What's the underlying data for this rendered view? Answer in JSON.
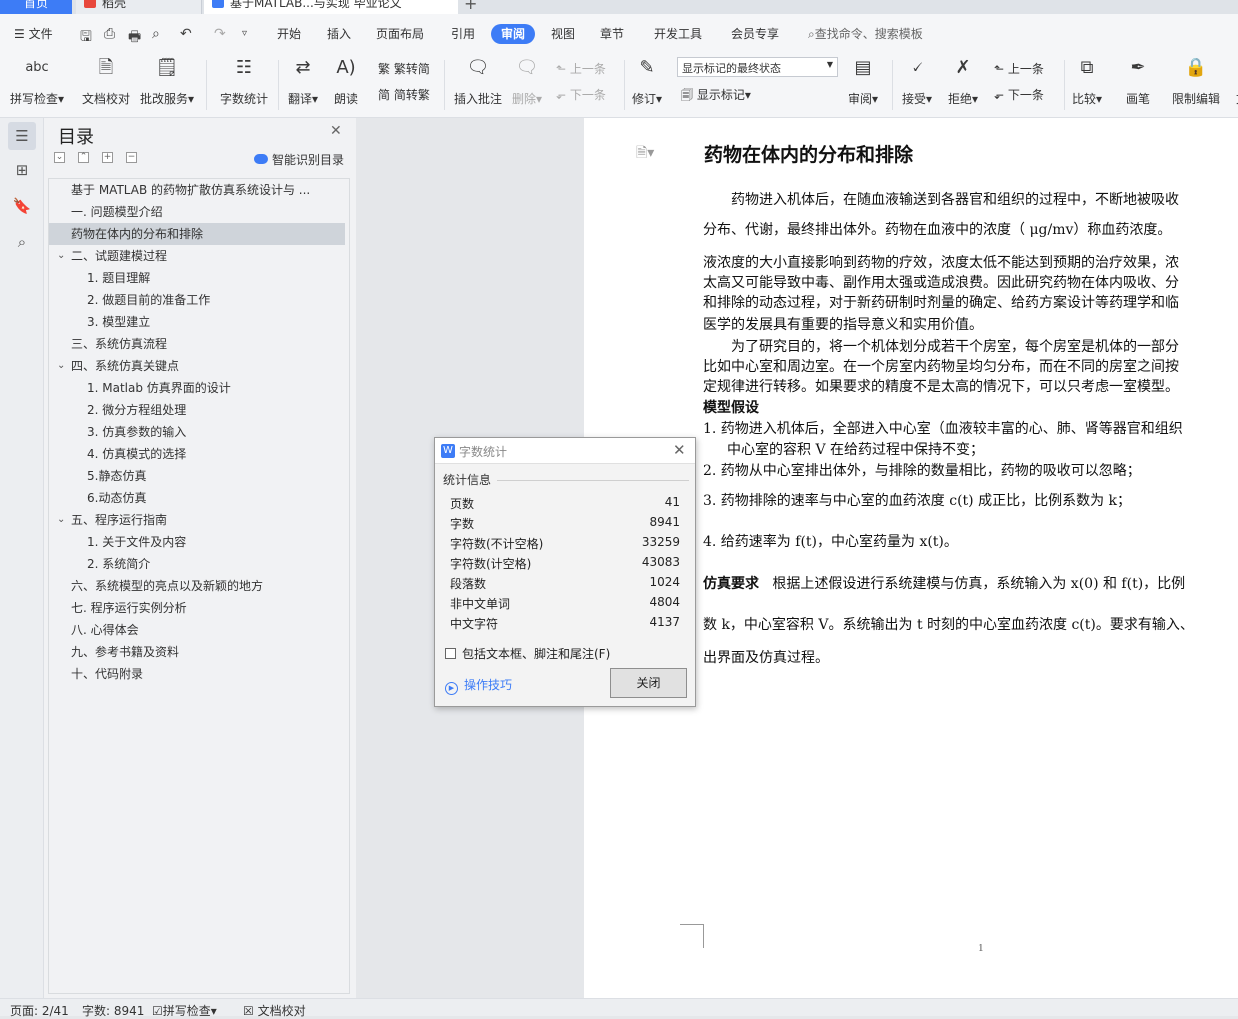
{
  "tabs": {
    "home": "首页",
    "dock": "稻壳",
    "doc": "基于MATLAB...与实现 毕业论文",
    "new": "+"
  },
  "menu": {
    "file": "文件",
    "items": [
      "开始",
      "插入",
      "页面布局",
      "引用",
      "审阅",
      "视图",
      "章节",
      "开发工具",
      "会员专享"
    ],
    "active": "审阅",
    "search": "查找命令、搜索模板"
  },
  "ribbon": {
    "spellcheck": "拼写检查",
    "doc_check": "文档校对",
    "revise_service": "批改服务",
    "word_count": "字数统计",
    "translate": "翻译",
    "read_aloud": "朗读",
    "trad_to_simp": "繁转简",
    "simp_to_trad": "简转繁",
    "insert_comment": "插入批注",
    "delete": "删除",
    "prev": "上一条",
    "next": "下一条",
    "track": "修订",
    "markup_select": "显示标记的最终状态",
    "show_markup": "显示标记",
    "review": "审阅",
    "accept": "接受",
    "reject": "拒绝",
    "prev2": "上一条",
    "next2": "下一条",
    "compare": "比较",
    "pen": "画笔",
    "restrict": "限制编辑",
    "more": "文"
  },
  "toc": {
    "title": "目录",
    "ai_label": "智能识别目录",
    "items": [
      {
        "text": "基于 MATLAB 的药物扩散仿真系统设计与 ..."
      },
      {
        "text": "一.   问题模型介绍"
      },
      {
        "text": "药物在体内的分布和排除"
      },
      {
        "text": "二、试题建模过程"
      },
      {
        "text": "1. 题目理解"
      },
      {
        "text": "2. 做题目前的准备工作"
      },
      {
        "text": "3. 模型建立"
      },
      {
        "text": "三、系统仿真流程"
      },
      {
        "text": "四、系统仿真关键点"
      },
      {
        "text": "1. Matlab 仿真界面的设计"
      },
      {
        "text": "2. 微分方程组处理"
      },
      {
        "text": "3. 仿真参数的输入"
      },
      {
        "text": "4. 仿真模式的选择"
      },
      {
        "text": "5.静态仿真"
      },
      {
        "text": "6.动态仿真"
      },
      {
        "text": "五、程序运行指南"
      },
      {
        "text": "1. 关于文件及内容"
      },
      {
        "text": "2. 系统简介"
      },
      {
        "text": "六、系统模型的亮点以及新颖的地方"
      },
      {
        "text": "七.   程序运行实例分析"
      },
      {
        "text": "八.   心得体会"
      },
      {
        "text": "九、参考书籍及资料"
      },
      {
        "text": "十、代码附录"
      }
    ]
  },
  "document": {
    "title": "药物在体内的分布和排除",
    "p1": "药物进入机体后，在随血液输送到各器官和组织的过程中，不断地被吸收",
    "p2": "分布、代谢，最终排出体外。药物在血液中的浓度（ μg/mv）称血药浓度。",
    "p3": "液浓度的大小直接影响到药物的疗效，浓度太低不能达到预期的治疗效果，浓",
    "p4": "太高又可能导致中毒、副作用太强或造成浪费。因此研究药物在体内吸收、分",
    "p5": "和排除的动态过程，对于新药研制时剂量的确定、给药方案设计等药理学和临",
    "p6": "医学的发展具有重要的指导意义和实用价值。",
    "p7": "为了研究目的，将一个机体划分成若干个房室，每个房室是机体的一部分",
    "p8": "比如中心室和周边室。在一个房室内药物呈均匀分布，而在不同的房室之间按",
    "p9": "定规律进行转移。如果要求的精度不是太高的情况下，可以只考虑一室模型。",
    "h2": "模型假设",
    "l1": "1.  药物进入机体后，全部进入中心室（血液较丰富的心、肺、肾等器官和组织",
    "l1b": "中心室的容积 V 在给药过程中保持不变；",
    "l2": "2.  药物从中心室排出体外，与排除的数量相比，药物的吸收可以忽略；",
    "l3": "3.  药物排除的速率与中心室的血药浓度 c(t) 成正比，比例系数为 k；",
    "l4": "4.  给药速率为 f(t)，中心室药量为 x(t)。",
    "req_label": "仿真要求",
    "r1": "根据上述假设进行系统建模与仿真，系统输入为 x(0) 和 f(t)，比例",
    "r2": "数 k，中心室容积 V。系统输出为 t 时刻的中心室血药浓度 c(t)。要求有输入、",
    "r3": "出界面及仿真过程。",
    "page_number": "1"
  },
  "dialog": {
    "title": "字数统计",
    "group": "统计信息",
    "stats": [
      {
        "label": "页数",
        "value": "41"
      },
      {
        "label": "字数",
        "value": "8941"
      },
      {
        "label": "字符数(不计空格)",
        "value": "33259"
      },
      {
        "label": "字符数(计空格)",
        "value": "43083"
      },
      {
        "label": "段落数",
        "value": "1024"
      },
      {
        "label": "非中文单词",
        "value": "4804"
      },
      {
        "label": "中文字符",
        "value": "4137"
      }
    ],
    "checkbox": "包括文本框、脚注和尾注(F)",
    "tips": "操作技巧",
    "close": "关闭"
  },
  "status": {
    "page": "页面: 2/41",
    "words": "字数: 8941",
    "spell": "拼写检查",
    "doc_check": "文档校对"
  },
  "colors": {
    "accent": "#3d7cf6",
    "selected_row": "#cfd4da"
  }
}
